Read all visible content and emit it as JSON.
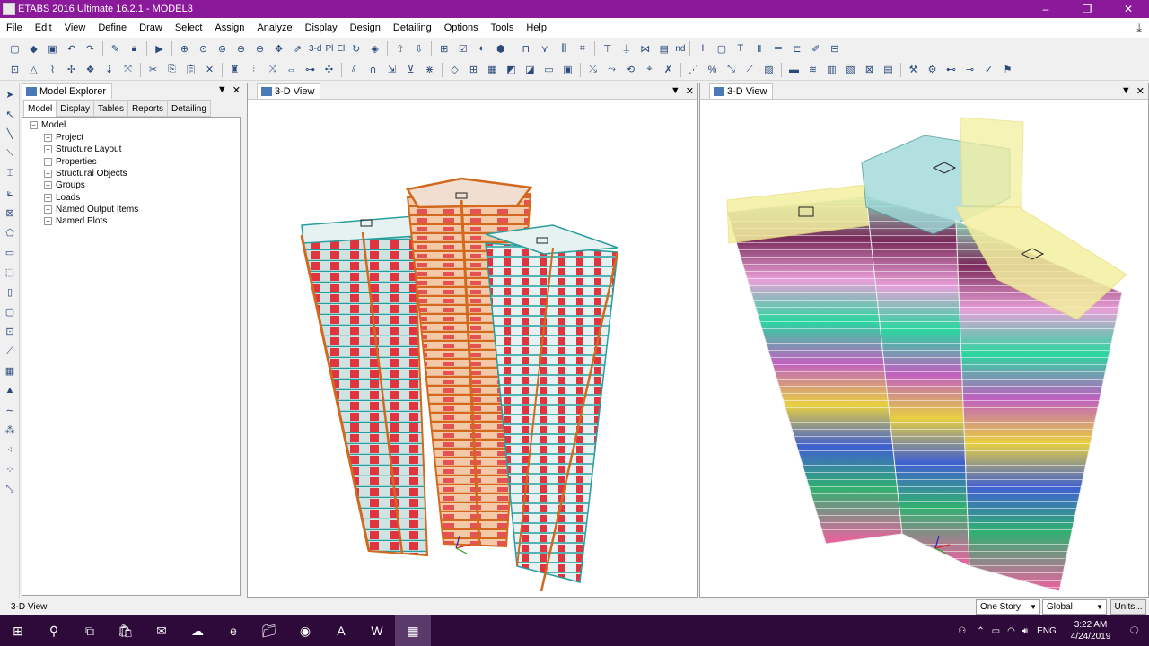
{
  "window": {
    "title": "ETABS 2016 Ultimate 16.2.1 - MODEL3",
    "controls": [
      "–",
      "❐",
      "✕"
    ]
  },
  "menu": [
    "File",
    "Edit",
    "View",
    "Define",
    "Draw",
    "Select",
    "Assign",
    "Analyze",
    "Display",
    "Design",
    "Detailing",
    "Options",
    "Tools",
    "Help"
  ],
  "toolbar": {
    "view_3d_label": "3-d",
    "plan_label": "Pl",
    "elev_label": "El",
    "nd_label": "nd"
  },
  "explorer": {
    "title": "Model Explorer",
    "tabs": [
      "Model",
      "Display",
      "Tables",
      "Reports",
      "Detailing"
    ],
    "root": "Model",
    "items": [
      "Project",
      "Structure Layout",
      "Properties",
      "Structural Objects",
      "Groups",
      "Loads",
      "Named Output Items",
      "Named Plots"
    ]
  },
  "views": [
    {
      "title": "3-D View"
    },
    {
      "title": "3-D View"
    }
  ],
  "status": {
    "text": "3-D View",
    "story": "One Story",
    "coord": "Global",
    "units": "Units..."
  },
  "taskbar": {
    "time": "3:22 AM",
    "date": "4/24/2019",
    "lang": "ENG"
  },
  "colors": {
    "titlebar": "#8b1a9b",
    "taskbar": "#2d0a3a",
    "steel_orange": "#d2691e",
    "panel_red": "#e0353f",
    "slab_teal": "#2a9d9d"
  }
}
